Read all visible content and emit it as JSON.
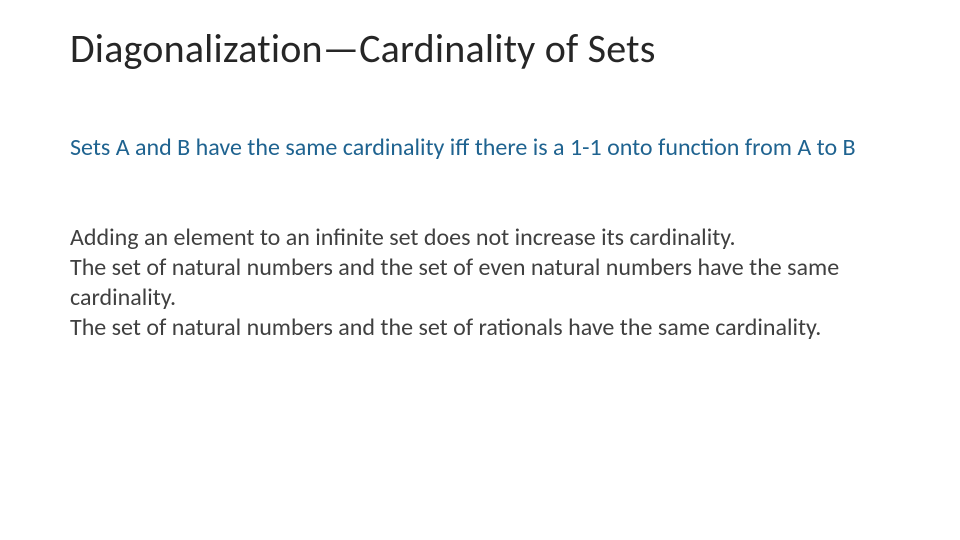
{
  "slide": {
    "title": "Diagonalization—Cardinality of Sets",
    "definition": "Sets A and B have the same cardinality iff there is a 1-1 onto function from A to B",
    "body": {
      "p1": "Adding an element to an  infinite set does not increase its cardinality.",
      "p2": "The set of natural numbers and the set of even natural numbers have the same cardinality.",
      "p3": "The set of natural numbers and the set of rationals have the same cardinality."
    }
  }
}
